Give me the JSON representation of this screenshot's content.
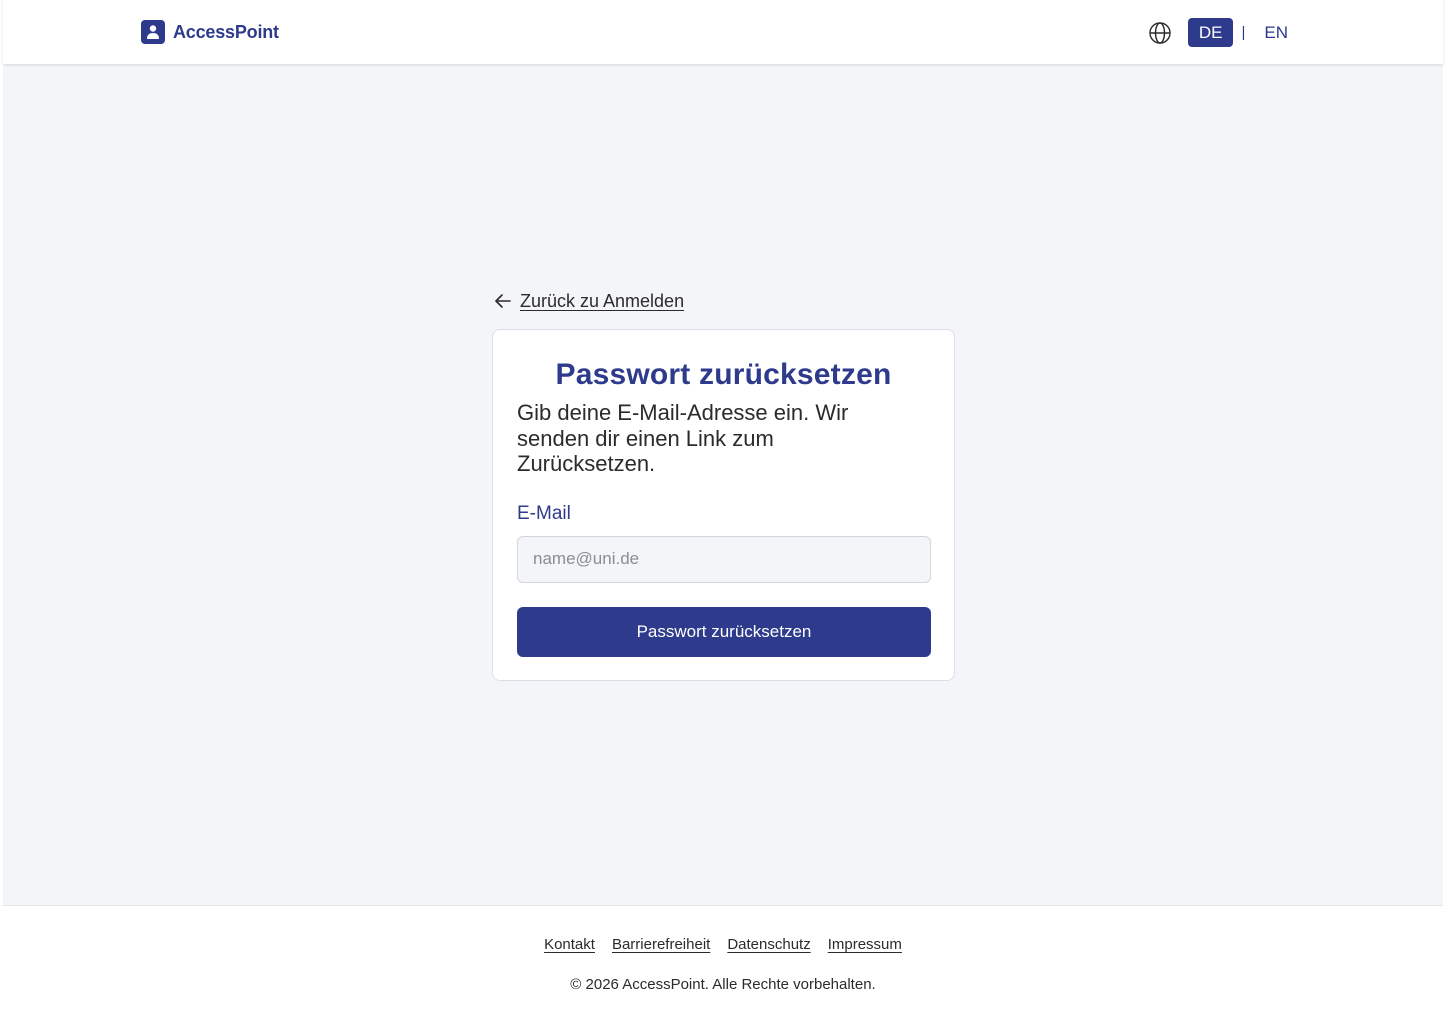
{
  "header": {
    "brand": "AccessPoint",
    "languages": [
      {
        "code": "DE",
        "active": true
      },
      {
        "code": "EN",
        "active": false
      }
    ],
    "lang_separator": "|",
    "globe_icon": "globe-icon"
  },
  "back_link": {
    "label": "Zurück zu Anmelden",
    "icon": "arrow-left-icon"
  },
  "card": {
    "title": "Passwort zurücksetzen",
    "description": "Gib deine E-Mail-Adresse ein. Wir senden dir einen Link zum Zurücksetzen.",
    "email_label": "E-Mail",
    "email_value": "",
    "email_placeholder": "name@uni.de",
    "submit_label": "Passwort zurücksetzen"
  },
  "footer": {
    "links": [
      "Kontakt",
      "Barrierefreiheit",
      "Datenschutz",
      "Impressum"
    ],
    "copyright": "© 2026 AccessPoint. Alle Rechte vorbehalten."
  },
  "colors": {
    "primary": "#2e3a8c",
    "page_background": "#f4f5f9",
    "text": "#2b2b2b"
  }
}
